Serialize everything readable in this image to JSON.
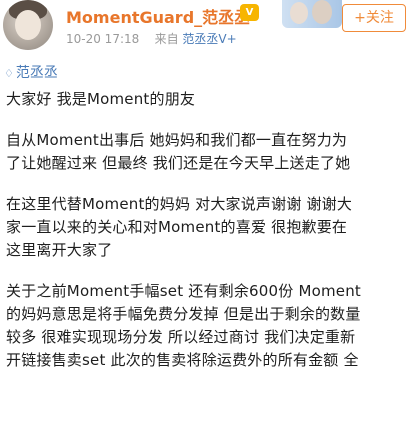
{
  "header": {
    "username": "MomentGuard_范丞丞",
    "vip_icon": "vip-crown-icon",
    "time": "10-20 17:18",
    "source_prefix": "来自",
    "source_name": "范丞丞V+",
    "follow_label": "+关注"
  },
  "topic": {
    "icon": "diamond-icon",
    "label": "范丞丞"
  },
  "post": {
    "lines": [
      "大家好 我是Moment的朋友",
      "自从Moment出事后 她妈妈和我们都一直在努力为",
      "了让她醒过来 但最终 我们还是在今天早上送走了她",
      "在这里代替Moment的妈妈 对大家说声谢谢 谢谢大",
      "家一直以来的关心和对Moment的喜爱 很抱歉要在",
      "这里离开大家了",
      "关于之前Moment手幅set 还有剩余600份 Moment",
      "的妈妈意思是将手幅免费分发掉 但是出于剩余的数量",
      "较多 很难实现现场分发 所以经过商讨 我们决定重新",
      "开链接售卖set 此次的售卖将除运费外的所有金额 全"
    ]
  },
  "colors": {
    "username": "#e8762b",
    "link": "#4a7bb7",
    "follow": "#f08b3a",
    "meta": "#9a9a9a"
  }
}
